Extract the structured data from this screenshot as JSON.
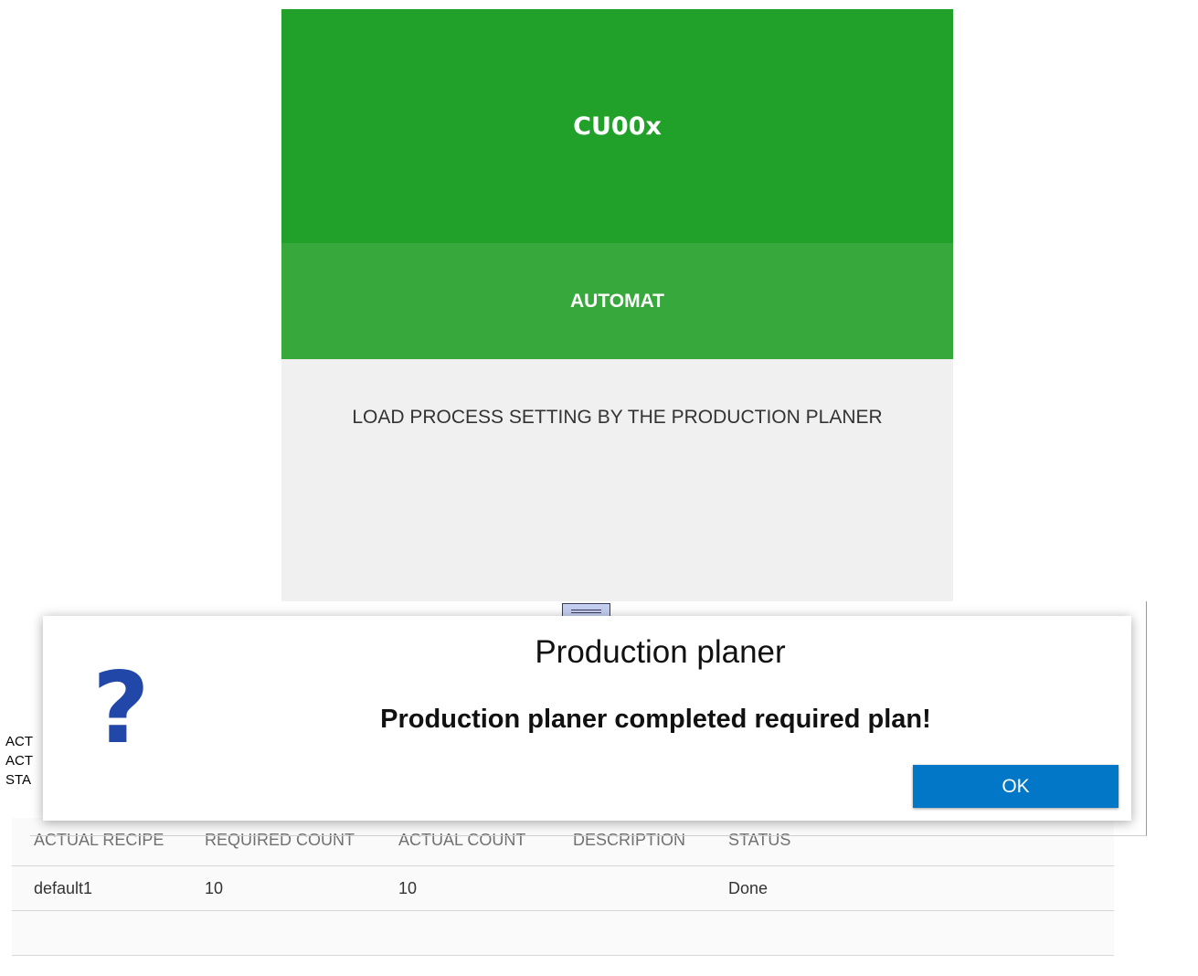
{
  "header": {
    "title": "CU00x",
    "mode": "AUTOMAT",
    "message": "LOAD PROCESS SETTING BY THE PRODUCTION PLANER"
  },
  "side_labels": [
    "ACT",
    "ACT",
    "STA"
  ],
  "table": {
    "columns": [
      "ACTUAL RECIPE",
      "REQUIRED COUNT",
      "ACTUAL COUNT",
      "DESCRIPTION",
      "STATUS"
    ],
    "rows": [
      {
        "recipe": "default1",
        "required": "10",
        "actual": "10",
        "description": "",
        "status": "Done"
      }
    ]
  },
  "dialog": {
    "icon": "question-mark-icon",
    "icon_glyph": "?",
    "title": "Production planer",
    "message": "Production planer completed required plan!",
    "ok_label": "OK"
  },
  "colors": {
    "title_bg": "#21a12a",
    "mode_bg": "#37a83b",
    "message_bg": "#f0f0f0",
    "icon": "#2147a8",
    "ok_button": "#0277c8"
  }
}
